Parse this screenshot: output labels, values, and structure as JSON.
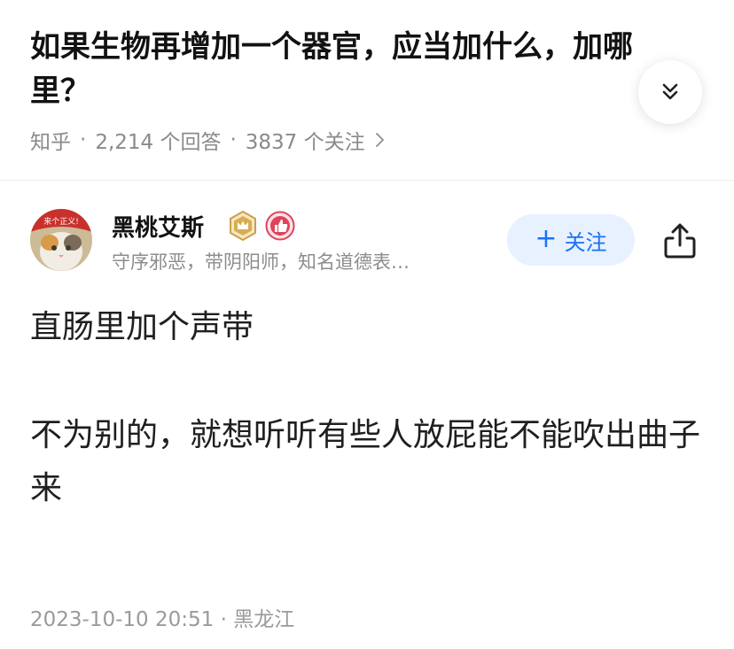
{
  "question": {
    "title": "如果生物再增加一个器官，应当加什么，加哪里？",
    "source": "知乎",
    "answers": "2,214 个回答",
    "followers": "3837 个关注",
    "separator": "·"
  },
  "author": {
    "name": "黑桃艾斯",
    "bio": "守序邪恶，带阴阳师，知名道德表…",
    "avatar_text": "来个正义!",
    "follow_label": "关注",
    "follow_plus": "+"
  },
  "answer": {
    "line1": "直肠里加个声带",
    "line2": "不为别的，就想听听有些人放屁能不能吹出曲子来"
  },
  "footer": {
    "datetime": "2023-10-10 20:51",
    "separator": "·",
    "location": "黑龙江"
  },
  "colors": {
    "accent": "#1772f6",
    "follow_bg": "#e8f1ff",
    "muted_text": "#8c8c8c",
    "badge_gold": "#c9a14a",
    "badge_red": "#e0435a"
  },
  "icons": {
    "collapse": "double-chevron-down-icon",
    "meta_arrow": "chevron-right-icon",
    "share": "share-icon",
    "crown_badge": "crown-badge-icon",
    "like_badge": "thumbs-up-badge-icon"
  }
}
